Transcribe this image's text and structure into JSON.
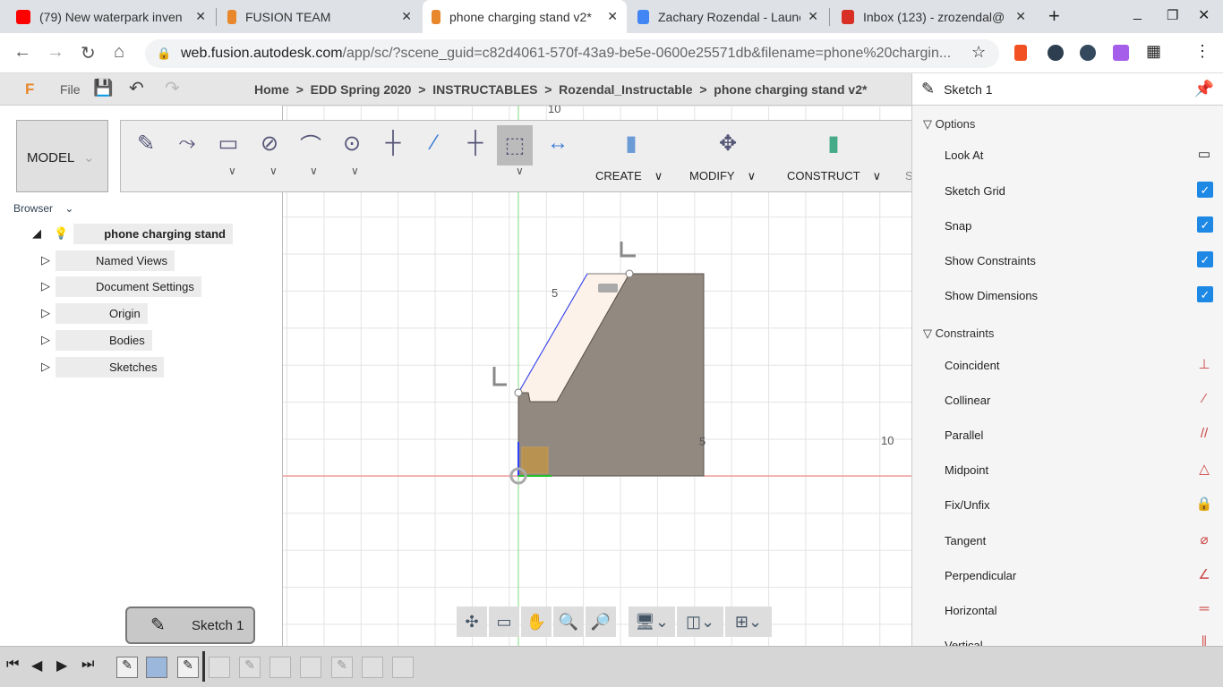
{
  "browser": {
    "tabs": [
      {
        "title": "(79) New waterpark inven",
        "icon": "youtube-icon",
        "color": "#ff0000"
      },
      {
        "title": "FUSION TEAM",
        "icon": "fusion-icon",
        "color": "#e8872c"
      },
      {
        "title": "phone charging stand v2*",
        "icon": "fusion-icon",
        "color": "#e8872c",
        "active": true
      },
      {
        "title": "Zachary Rozendal - Launc",
        "icon": "docs-icon",
        "color": "#4285f4"
      },
      {
        "title": "Inbox (123) - zrozendal@",
        "icon": "gmail-icon",
        "color": "#d93025"
      }
    ],
    "url_host": "web.fusion.autodesk.com",
    "url_path": "/app/sc/?scene_guid=c82d4061-570f-43a9-be5e-0600e25571db&filename=phone%20chargin..."
  },
  "app": {
    "file_label": "File",
    "breadcrumb": [
      "Home",
      ">",
      "EDD Spring 2020",
      ">",
      "INSTRUCTABLES",
      ">",
      "Rozendal_Instructable",
      ">",
      "phone charging stand v2*"
    ],
    "workspace": "MODEL",
    "toolbar_groups": [
      "CREATE",
      "MODIFY",
      "CONSTRUCT",
      "S"
    ]
  },
  "browser_panel": {
    "title": "Browser",
    "root": "phone charging stand",
    "items": [
      "Named Views",
      "Document Settings",
      "Origin",
      "Bodies",
      "Sketches"
    ]
  },
  "canvas": {
    "labels": [
      "10",
      "5",
      "5",
      "10"
    ]
  },
  "sketch_palette": {
    "title": "Sketch 1",
    "options_title": "Options",
    "options": [
      {
        "label": "Look At",
        "type": "button"
      },
      {
        "label": "Sketch Grid",
        "checked": true
      },
      {
        "label": "Snap",
        "checked": true
      },
      {
        "label": "Show Constraints",
        "checked": true
      },
      {
        "label": "Show Dimensions",
        "checked": true
      }
    ],
    "constraints_title": "Constraints",
    "constraints": [
      {
        "label": "Coincident",
        "icon": "coincident-icon"
      },
      {
        "label": "Collinear",
        "icon": "collinear-icon"
      },
      {
        "label": "Parallel",
        "icon": "parallel-icon"
      },
      {
        "label": "Midpoint",
        "icon": "midpoint-icon"
      },
      {
        "label": "Fix/Unfix",
        "icon": "lock-icon"
      },
      {
        "label": "Tangent",
        "icon": "tangent-icon"
      },
      {
        "label": "Perpendicular",
        "icon": "perpendicular-icon"
      },
      {
        "label": "Horizontal",
        "icon": "horizontal-icon"
      },
      {
        "label": "Vertical",
        "icon": "vertical-icon"
      }
    ]
  },
  "timeline": {
    "tooltip": "Sketch 1"
  }
}
